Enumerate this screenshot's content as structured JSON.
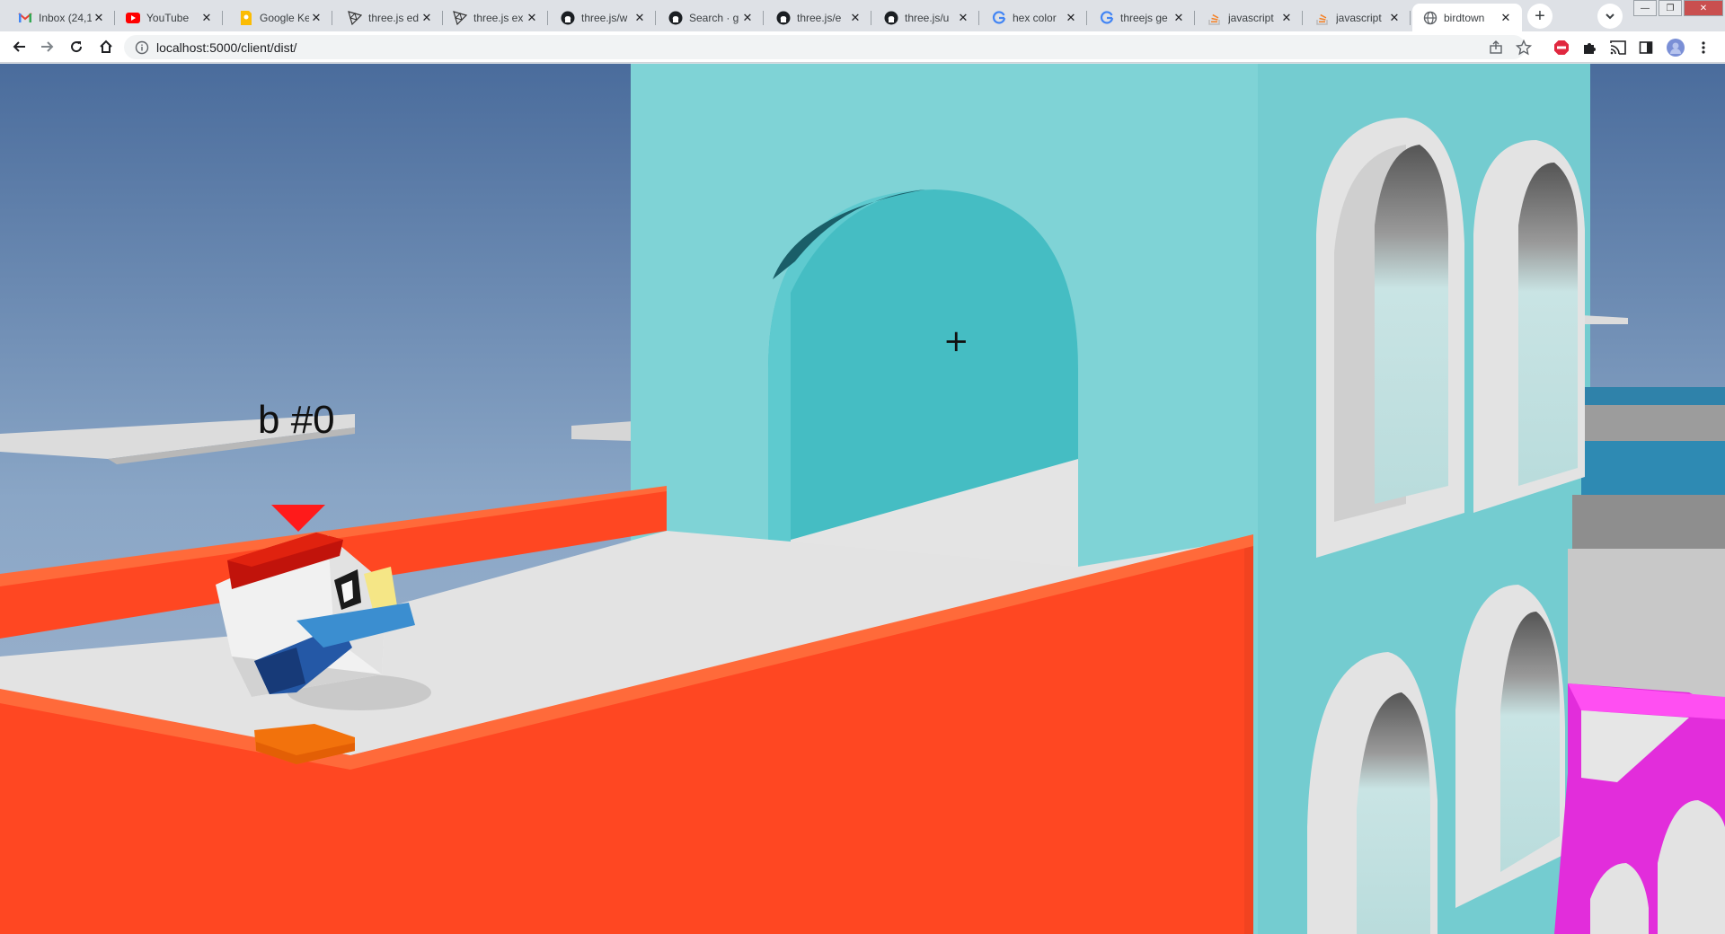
{
  "browser": {
    "tabs": [
      {
        "title": "Inbox (24,1",
        "icon": "gmail-icon",
        "active": false
      },
      {
        "title": "YouTube",
        "icon": "youtube-icon",
        "active": false
      },
      {
        "title": "Google Ke",
        "icon": "google-keep-icon",
        "active": false
      },
      {
        "title": "three.js ed",
        "icon": "threejs-icon",
        "active": false
      },
      {
        "title": "three.js ex",
        "icon": "threejs-icon",
        "active": false
      },
      {
        "title": "three.js/w",
        "icon": "github-icon",
        "active": false
      },
      {
        "title": "Search · g",
        "icon": "github-icon",
        "active": false
      },
      {
        "title": "three.js/e",
        "icon": "github-icon",
        "active": false
      },
      {
        "title": "three.js/u",
        "icon": "github-icon",
        "active": false
      },
      {
        "title": "hex color",
        "icon": "google-icon",
        "active": false
      },
      {
        "title": "threejs ge",
        "icon": "google-icon",
        "active": false
      },
      {
        "title": "javascript",
        "icon": "stackoverflow-icon",
        "active": false
      },
      {
        "title": "javascript",
        "icon": "stackoverflow-icon",
        "active": false
      },
      {
        "title": "birdtown",
        "icon": "globe-icon",
        "active": true
      }
    ],
    "url": "localhost:5000/client/dist/",
    "new_tab": "+"
  },
  "game": {
    "player_label": "b #0",
    "crosshair": "+"
  },
  "colors": {
    "sky_top": "#4f72a0",
    "sky_bottom": "#a4b8cf",
    "orange_wall": "#ff4722",
    "orange_top": "#ff6a3a",
    "cyan_building": "#7dd3d6",
    "cyan_arch_inside": "#45bec4",
    "floor": "#e2e2e2",
    "magenta": "#ff3ef0",
    "label_marker": "#ff1a1a"
  }
}
